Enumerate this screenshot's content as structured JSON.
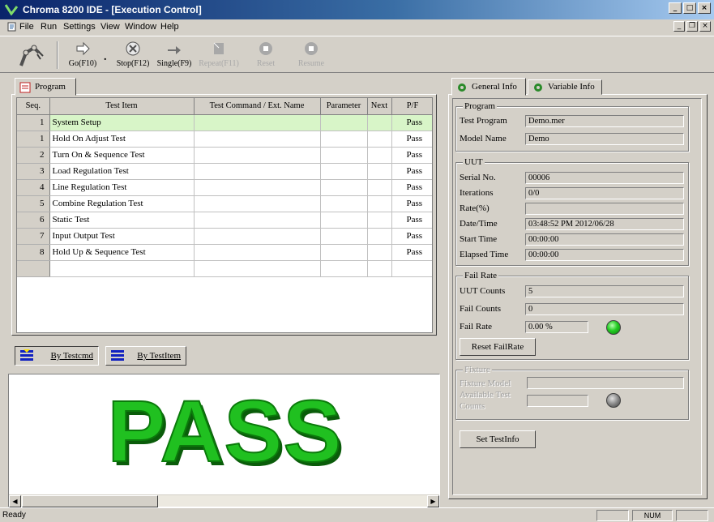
{
  "window": {
    "title": "Chroma 8200 IDE - [Execution Control]",
    "min_glyph": "_",
    "max_glyph": "□",
    "close_glyph": "×",
    "restore_glyph": "❐"
  },
  "menu": [
    "File",
    "Run",
    "Settings",
    "View",
    "Window",
    "Help"
  ],
  "toolbar": {
    "go": "Go(F10)",
    "stop": "Stop(F12)",
    "single": "Single(F9)",
    "repeat": "Repeat(F11)",
    "reset": "Reset",
    "resume": "Resume"
  },
  "program": {
    "tab_label": "Program",
    "columns": [
      "Seq.",
      "Test Item",
      "Test Command / Ext. Name",
      "Parameter",
      "Next",
      "P/F"
    ],
    "rows": [
      {
        "seq": "1",
        "item": "System Setup",
        "pf": "Pass"
      },
      {
        "seq": "1",
        "item": "Hold On Adjust Test",
        "pf": "Pass"
      },
      {
        "seq": "2",
        "item": "Turn On & Sequence Test",
        "pf": "Pass"
      },
      {
        "seq": "3",
        "item": "Load Regulation Test",
        "pf": "Pass"
      },
      {
        "seq": "4",
        "item": "Line Regulation Test",
        "pf": "Pass"
      },
      {
        "seq": "5",
        "item": "Combine Regulation Test",
        "pf": "Pass"
      },
      {
        "seq": "6",
        "item": "Static Test",
        "pf": "Pass"
      },
      {
        "seq": "7",
        "item": "Input Output Test",
        "pf": "Pass"
      },
      {
        "seq": "8",
        "item": "Hold Up & Sequence Test",
        "pf": "Pass"
      }
    ],
    "by_testcmd": "By Testcmd",
    "by_testitem": "By TestItem",
    "result": "PASS"
  },
  "info": {
    "tab_general": "General Info",
    "tab_variable": "Variable Info",
    "program_group": "Program",
    "test_program_label": "Test Program",
    "test_program_value": "Demo.mer",
    "model_name_label": "Model Name",
    "model_name_value": "Demo",
    "uut_group": "UUT",
    "serial_no_label": "Serial No.",
    "serial_no_value": "00006",
    "iterations_label": "Iterations",
    "iterations_value": "0/0",
    "rate_label": "Rate(%)",
    "rate_value": "",
    "datetime_label": "Date/Time",
    "datetime_value": "03:48:52 PM 2012/06/28",
    "start_time_label": "Start Time",
    "start_time_value": "00:00:00",
    "elapsed_time_label": "Elapsed Time",
    "elapsed_time_value": "00:00:00",
    "fail_rate_group": "Fail Rate",
    "uut_counts_label": "UUT Counts",
    "uut_counts_value": "5",
    "fail_counts_label": "Fail Counts",
    "fail_counts_value": "0",
    "fail_rate_label": "Fail Rate",
    "fail_rate_value": "0.00 %",
    "reset_failrate": "Reset FailRate",
    "fixture_group": "Fixture",
    "fixture_model_label": "Fixture Model",
    "available_test_label_1": "Available Test",
    "available_test_label_2": "Counts",
    "set_testinfo": "Set TestInfo",
    "led_fail_color": "#22cc22",
    "led_fixture_color": "#808080"
  },
  "status": {
    "message": "Ready",
    "num": "NUM"
  },
  "colors": {
    "title_start": "#0a246a",
    "pass_green": "#20c020",
    "selected_row": "#d8f5c8"
  }
}
